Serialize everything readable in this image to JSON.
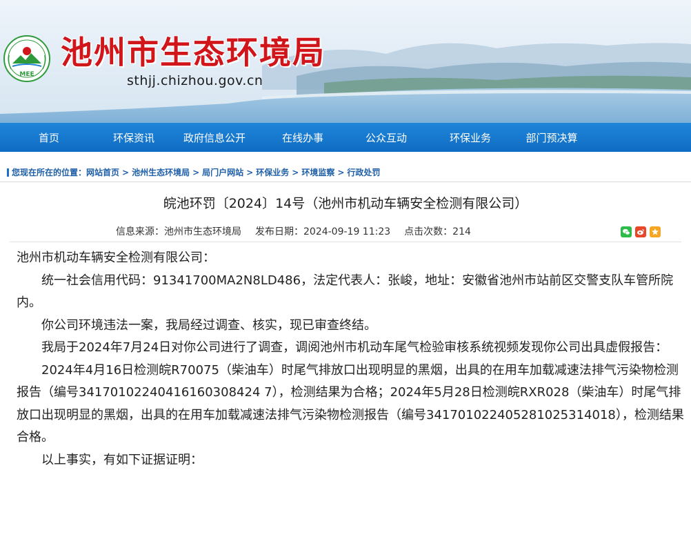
{
  "header": {
    "site_title": "池州市生态环境局",
    "site_domain": "sthjj.chizhou.gov.cn",
    "logo_text": "MEE",
    "brand_red": "#d0161b",
    "brand_green": "#2e9a3b"
  },
  "nav": {
    "items": [
      "首页",
      "环保资讯",
      "政府信息公开",
      "在线办事",
      "公众互动",
      "环保业务",
      "部门预决算"
    ],
    "bg_color": "#1a7bd0"
  },
  "breadcrumb": {
    "label": "您现在所在的位置：",
    "items": [
      "网站首页",
      "池州生态环境局",
      "局门户网站",
      "环保业务",
      "环境监察",
      "行政处罚"
    ],
    "separator": ">"
  },
  "article": {
    "title": "皖池环罚〔2024〕14号（池州市机动车辆安全检测有限公司）",
    "meta": {
      "source_label": "信息来源：",
      "source": "池州市生态环境局",
      "date_label": "发布日期：",
      "date": "2024-09-19 11:23",
      "clicks_label": "点击次数：",
      "clicks": "214"
    },
    "share_icons": [
      "wechat-icon",
      "weibo-icon",
      "favorite-icon"
    ],
    "paragraphs": [
      "池州市机动车辆安全检测有限公司：",
      "统一社会信用代码：91341700MA2N8LD486，法定代表人：张峻，地址：安徽省池州市站前区交警支队车管所院内。",
      "你公司环境违法一案，我局经过调查、核实，现已审查终结。",
      "我局于2024年7月24日对你公司进行了调查，调阅池州市机动车尾气检验审核系统视频发现你公司出具虚假报告：",
      "2024年4月16日检测皖R70075（柴油车）时尾气排放口出现明显的黑烟，出具的在用车加载减速法排气污染物检测报告（编号34170102240416160308424 7），检测结果为合格；2024年5月28日检测皖RXR028（柴油车）时尾气排放口出现明显的黑烟，出具的在用车加载减速法排气污染物检测报告（编号341701022405281025314018），检测结果合格。",
      "以上事实，有如下证据证明："
    ]
  }
}
